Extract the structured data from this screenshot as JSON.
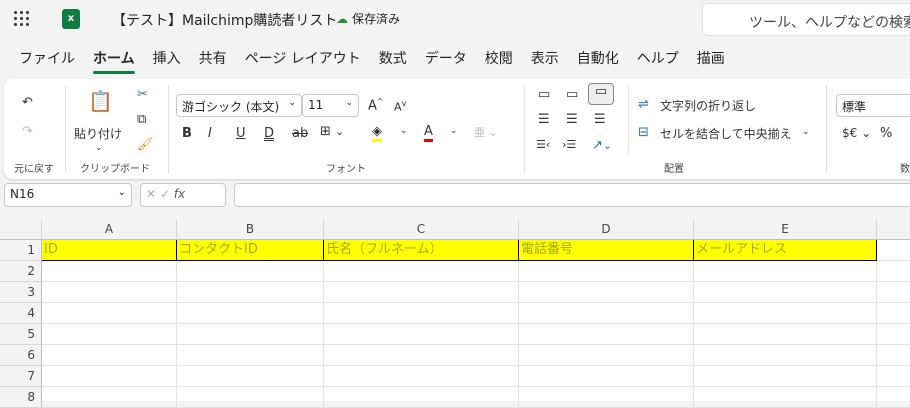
{
  "app": {
    "title": "【テスト】Mailchimp購読者リスト",
    "save_status": "保存済み",
    "search_placeholder": "ツール、ヘルプなどの検索"
  },
  "tabs": [
    "ファイル",
    "ホーム",
    "挿入",
    "共有",
    "ページ レイアウト",
    "数式",
    "データ",
    "校閲",
    "表示",
    "自動化",
    "ヘルプ",
    "描画"
  ],
  "active_tab": "ホーム",
  "ribbon": {
    "undo_group": "元に戻す",
    "clipboard": {
      "paste": "貼り付け",
      "label": "クリップボード"
    },
    "font": {
      "name": "游ゴシック (本文)",
      "size": "11",
      "label": "フォント"
    },
    "alignment": {
      "wrap": "文字列の折り返し",
      "merge": "セルを結合して中央揃え",
      "label": "配置"
    },
    "number": {
      "format": "標準",
      "currency": "$€",
      "percent": "%",
      "label": "数"
    }
  },
  "formula_bar": {
    "name_box": "N16",
    "fx": "fx",
    "value": ""
  },
  "sheet": {
    "columns": [
      "A",
      "B",
      "C",
      "D",
      "E"
    ],
    "rows": [
      "1",
      "2",
      "3",
      "4",
      "5",
      "6",
      "7",
      "8"
    ],
    "header_row": [
      "ID",
      "コンタクトID",
      "氏名（フルネーム）",
      "電話番号",
      "メールアドレス"
    ],
    "header_fill": "#ffff00"
  }
}
